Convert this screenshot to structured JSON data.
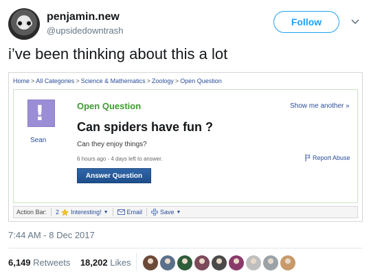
{
  "tweet": {
    "display_name": "penjamin.new",
    "handle": "@upsidedowntrash",
    "follow_label": "Follow",
    "text": "i’ve been thinking about this a lot",
    "timestamp": "7:44 AM - 8 Dec 2017",
    "retweets_count": "6,149",
    "retweets_label": "Retweets",
    "likes_count": "18,202",
    "likes_label": "Likes"
  },
  "screenshot": {
    "breadcrumb": [
      "Home",
      "All Categories",
      "Science & Mathematics",
      "Zoology",
      "Open Question"
    ],
    "status_label": "Open Question",
    "show_more": "Show me another »",
    "asker": "Sean",
    "question_title": "Can spiders have fun ?",
    "question_body": "Can they enjoy things?",
    "meta": "6 hours ago - 4 days left to answer.",
    "report_label": "Report Abuse",
    "answer_button": "Answer Question",
    "action_bar": {
      "label": "Action Bar:",
      "interesting_count": "2",
      "interesting_label": "Interesting!",
      "email_label": "Email",
      "save_label": "Save"
    }
  },
  "colors": {
    "twitter_blue": "#1da1f2",
    "open_question_green": "#3d9b2f",
    "link_blue": "#2a4d9b",
    "answer_button": "#1f4f8c",
    "avatar_purple": "#9b8dd6"
  },
  "likers": [
    "#6b4a3a",
    "#5a6f8a",
    "#2e5d3a",
    "#7a4a5a",
    "#4a4a4a",
    "#8a3a6a",
    "#bfbfbf",
    "#9aa2a8",
    "#c89a6a"
  ]
}
